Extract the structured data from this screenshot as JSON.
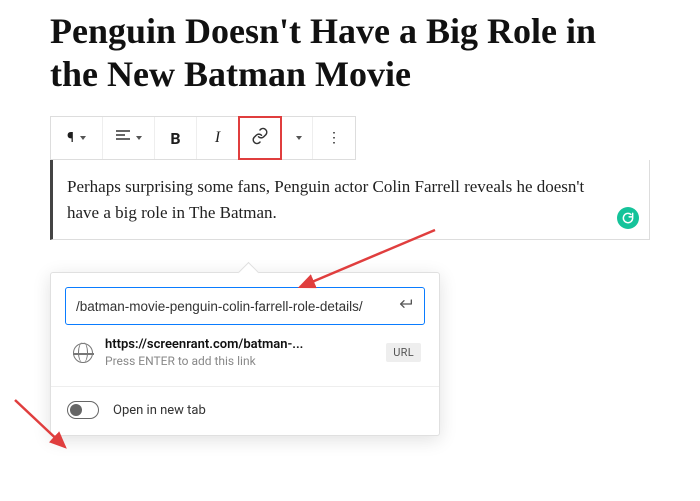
{
  "post": {
    "title": "Penguin Doesn't Have a Big Role in the New Batman Movie",
    "paragraph": "Perhaps surprising some fans, Penguin actor Colin Farrell reveals he doesn't have a big role in The Batman."
  },
  "toolbar": {
    "bold_glyph": "B",
    "italic_glyph": "I",
    "more_glyph": "⋮"
  },
  "link_popover": {
    "url_value": "/batman-movie-penguin-colin-farrell-role-details/",
    "suggestion_title": "https://screenrant.com/batman-...",
    "suggestion_hint": "Press ENTER to add this link",
    "url_chip": "URL",
    "open_in_new_tab_label": "Open in new tab",
    "open_in_new_tab_on": false
  },
  "colors": {
    "highlight_border": "#e03e3e",
    "focus_border": "#0a7cff",
    "grammarly": "#15c39a"
  }
}
